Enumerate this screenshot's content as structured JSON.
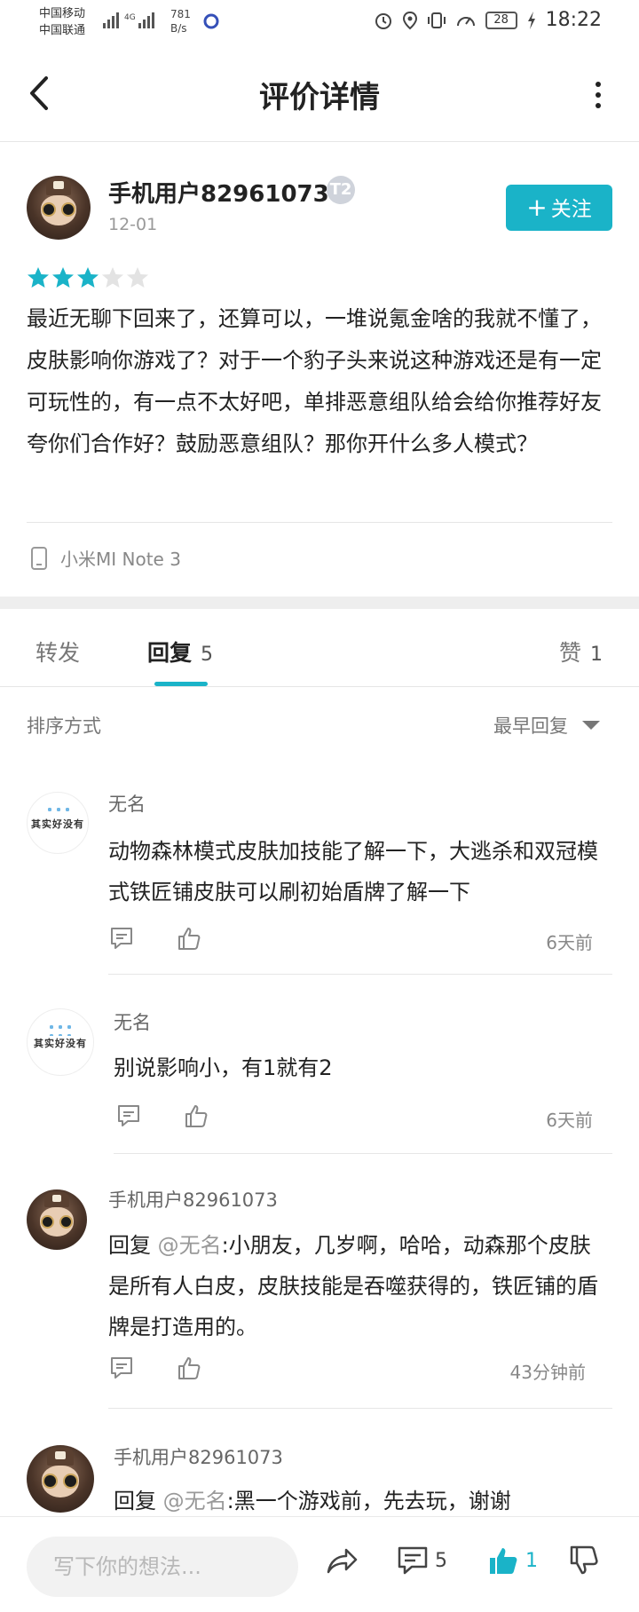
{
  "status_bar": {
    "carrier1": "中国移动",
    "carrier2": "中国联通",
    "network_label": "4G",
    "speed_value": "781",
    "speed_unit": "B/s",
    "battery": "28",
    "time": "18:22"
  },
  "header": {
    "title": "评价详情"
  },
  "review": {
    "username": "手机用户82961073",
    "level_badge": "T2",
    "date": "12-01",
    "follow_label": "关注",
    "rating": 3,
    "rating_max": 5,
    "text": "最近无聊下回来了，还算可以，一堆说氪金啥的我就不懂了，皮肤影响你游戏了？对于一个豹子头来说这种游戏还是有一定可玩性的，有一点不太好吧，单排恶意组队给会给你推荐好友 夸你们合作好？鼓励恶意组队？那你开什么多人模式？",
    "device": "小米MI Note 3"
  },
  "tabs": {
    "forward": "转发",
    "reply": "回复",
    "reply_count": "5",
    "like": "赞",
    "like_count": "1"
  },
  "sort": {
    "label": "排序方式",
    "value": "最早回复"
  },
  "comments": [
    {
      "name": "无名",
      "avatar_text": "其实好没有",
      "text": "动物森林模式皮肤加技能了解一下，大逃杀和双冠模式铁匠铺皮肤可以刷初始盾牌了解一下",
      "time": "6天前"
    },
    {
      "name": "无名",
      "avatar_text": "其实好没有",
      "text": "别说影响小，有1就有2",
      "time": "6天前"
    },
    {
      "name": "手机用户82961073",
      "reply_prefix": "回复",
      "mention": "@无名",
      "text": ":小朋友，几岁啊，哈哈，动森那个皮肤是所有人白皮，皮肤技能是吞噬获得的，铁匠铺的盾牌是打造用的。",
      "time": "43分钟前"
    },
    {
      "name": "手机用户82961073",
      "reply_prefix": "回复",
      "mention": "@无名",
      "text": ":黑一个游戏前，先去玩，谢谢"
    }
  ],
  "bottom_bar": {
    "placeholder": "写下你的想法...",
    "comment_count": "5",
    "like_count": "1"
  },
  "colors": {
    "accent": "#1ab3c8",
    "star_empty": "#e3e3e3"
  }
}
